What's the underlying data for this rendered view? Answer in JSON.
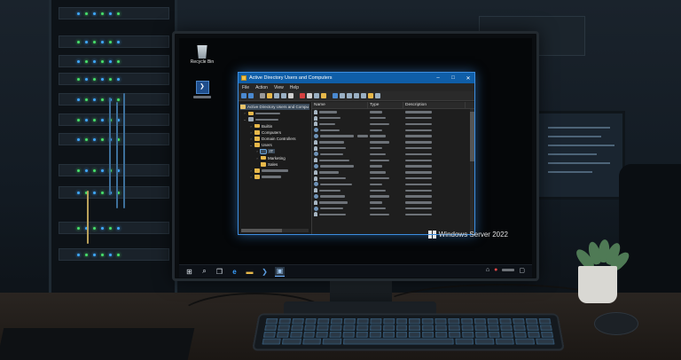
{
  "desktop": {
    "icons": [
      {
        "label": "Recycle Bin"
      },
      {
        "label": ""
      }
    ],
    "watermark": "Windows Server 2022"
  },
  "window": {
    "title": "Active Directory Users and Computers",
    "controls": {
      "minimize": "–",
      "maximize": "□",
      "close": "✕"
    },
    "menu": [
      "File",
      "Action",
      "View",
      "Help"
    ],
    "tree": {
      "root": "Active Directory Users and Compu",
      "nodes": [
        {
          "label": "Builtin",
          "depth": 2
        },
        {
          "label": "Computers",
          "depth": 2
        },
        {
          "label": "Domain Controllers",
          "depth": 2
        },
        {
          "label": "Users",
          "depth": 2
        },
        {
          "label": "IT",
          "depth": 3
        },
        {
          "label": "Marketing",
          "depth": 3
        },
        {
          "label": "Sales",
          "depth": 3
        }
      ]
    },
    "columns": [
      "Name",
      "Type",
      "Description"
    ]
  },
  "taskbar": {
    "start_glyph": "⊞",
    "search_glyph": "⌕",
    "taskview_glyph": "❐",
    "browser_glyph": "e",
    "explorer_glyph": "▬",
    "powershell_glyph": "❯",
    "aduc_glyph": "▣"
  },
  "colors": {
    "accent": "#0f5ea8",
    "window_glow": "#3c8de0",
    "folder": "#e7b84a"
  }
}
